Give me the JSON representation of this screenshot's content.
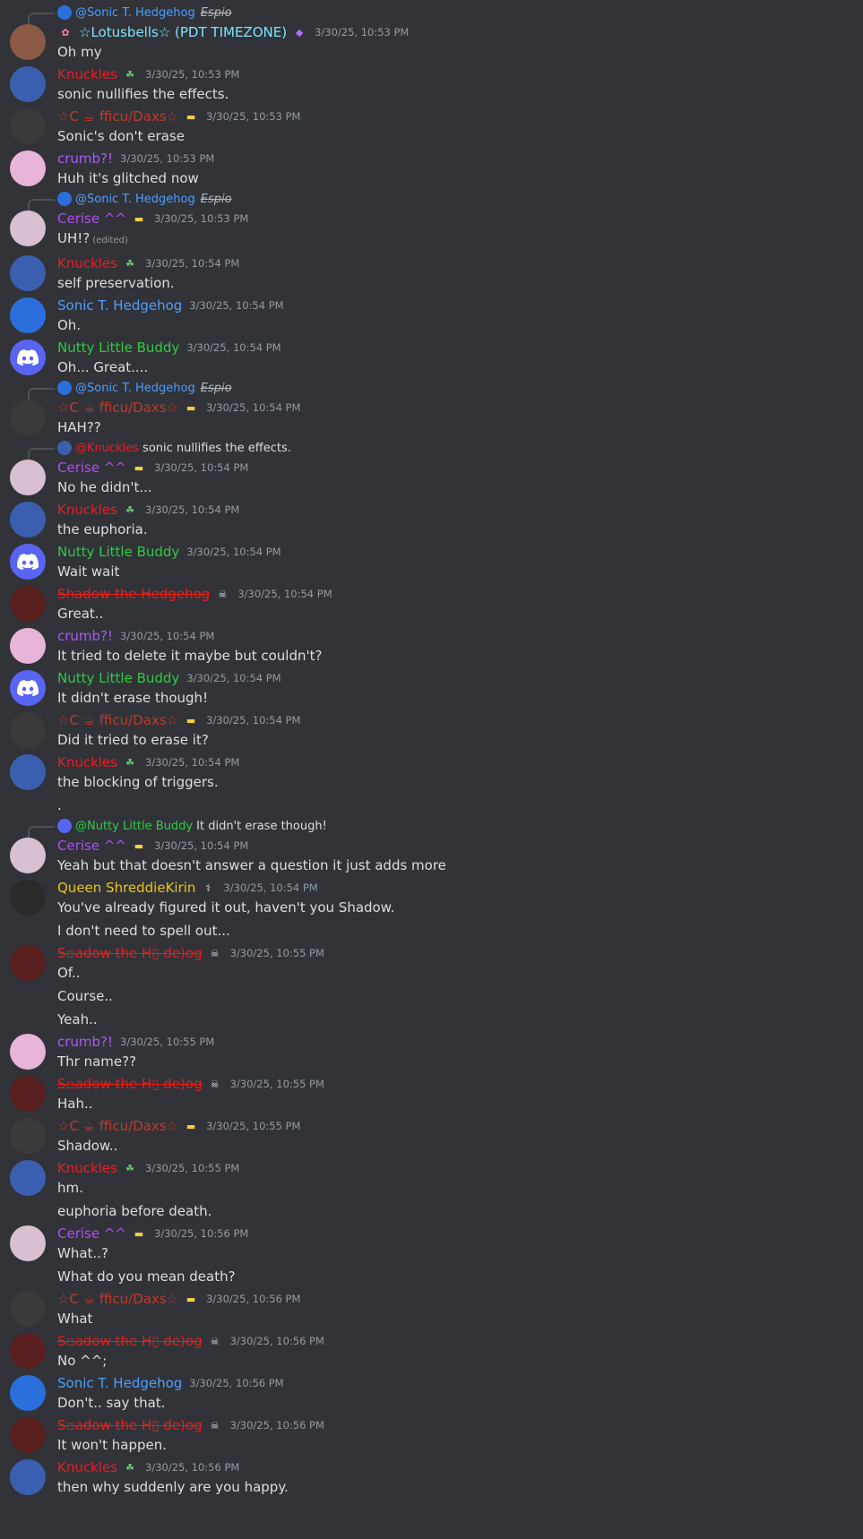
{
  "colors": {
    "background": "#313338",
    "knuckles": "#ed1c24",
    "daxs": "#c0392b",
    "crumb": "#a95cf5",
    "cerise": "#b04ef0",
    "sonic": "#4e9eff",
    "nutty": "#2ecc40",
    "shadow": "#e0211d",
    "queen": "#f1c40f",
    "lotus": "#7ee3ff"
  },
  "messages": [
    {
      "reply": {
        "mention": "@Sonic T. Hedgehog",
        "text": "",
        "tag": "Espio"
      },
      "author": "☆Lotusbells☆ (PDT TIMEZONE)",
      "time": "3/30/25, 10:53 PM",
      "lines": [
        "Oh my"
      ]
    },
    {
      "author": "Knuckles",
      "time": "3/30/25, 10:53 PM",
      "lines": [
        "sonic nullifies the effects."
      ]
    },
    {
      "author": "☆C ☕ fficu/Daxs☆",
      "time": "3/30/25, 10:53 PM",
      "lines": [
        "Sonic's don't erase"
      ]
    },
    {
      "author": "crumb?!",
      "time": "3/30/25, 10:53 PM",
      "lines": [
        "Huh it's glitched now"
      ]
    },
    {
      "reply": {
        "mention": "@Sonic T. Hedgehog",
        "text": "",
        "tag": "Espio"
      },
      "author": "Cerise ^^",
      "time": "3/30/25, 10:53 PM",
      "lines": [
        "UH!?"
      ],
      "edited": "(edited)"
    },
    {
      "author": "Knuckles",
      "time": "3/30/25, 10:54 PM",
      "lines": [
        "self preservation."
      ]
    },
    {
      "author": "Sonic T. Hedgehog",
      "time": "3/30/25, 10:54 PM",
      "lines": [
        "Oh."
      ]
    },
    {
      "author": "Nutty Little Buddy",
      "time": "3/30/25, 10:54 PM",
      "lines": [
        "Oh... Great...."
      ]
    },
    {
      "reply": {
        "mention": "@Sonic T. Hedgehog",
        "text": "",
        "tag": "Espio"
      },
      "author": "☆C ☕ fficu/Daxs☆",
      "time": "3/30/25, 10:54 PM",
      "lines": [
        "HAH??"
      ]
    },
    {
      "reply": {
        "mention": "@Knuckles",
        "text": "sonic nullifies the effects.",
        "tag": ""
      },
      "author": "Cerise ^^",
      "time": "3/30/25, 10:54 PM",
      "lines": [
        "No he didn't..."
      ]
    },
    {
      "author": "Knuckles",
      "time": "3/30/25, 10:54 PM",
      "lines": [
        "the euphoria."
      ]
    },
    {
      "author": "Nutty Little Buddy",
      "time": "3/30/25, 10:54 PM",
      "lines": [
        "Wait wait"
      ]
    },
    {
      "author": "Shadow the Hedgehog",
      "time": "3/30/25, 10:54 PM",
      "lines": [
        "Great.."
      ]
    },
    {
      "author": "crumb?!",
      "time": "3/30/25, 10:54 PM",
      "lines": [
        "It tried to delete it maybe but couldn't?"
      ]
    },
    {
      "author": "Nutty Little Buddy",
      "time": "3/30/25, 10:54 PM",
      "lines": [
        "It didn't erase though!"
      ]
    },
    {
      "author": "☆C ☕ fficu/Daxs☆",
      "time": "3/30/25, 10:54 PM",
      "lines": [
        "Did it tried to erase it?"
      ]
    },
    {
      "author": "Knuckles",
      "time": "3/30/25, 10:54 PM",
      "lines": [
        "the blocking of triggers.",
        "."
      ]
    },
    {
      "reply": {
        "mention": "@Nutty Little Buddy",
        "text": "It didn't erase though!",
        "tag": ""
      },
      "author": "Cerise ^^",
      "time": "3/30/25, 10:54 PM",
      "lines": [
        "Yeah but that doesn't answer a question it just adds more"
      ]
    },
    {
      "author": "Queen ShreddieKirin",
      "time": "3/30/25, 10:54 PM",
      "lines": [
        "You've already figured it out, haven't you Shadow.",
        "I don't need to spell out..."
      ]
    },
    {
      "author": "S▫adow the H▯ de)og",
      "time": "3/30/25, 10:55 PM",
      "lines": [
        "Of..",
        "Course..",
        "Yeah.."
      ]
    },
    {
      "author": "crumb?!",
      "time": "3/30/25, 10:55 PM",
      "lines": [
        "Thr name??"
      ]
    },
    {
      "author": "S▫adow the H▯ de)og",
      "time": "3/30/25, 10:55 PM",
      "lines": [
        "Hah.."
      ]
    },
    {
      "author": "☆C ☕ fficu/Daxs☆",
      "time": "3/30/25, 10:55 PM",
      "lines": [
        "Shadow.."
      ]
    },
    {
      "author": "Knuckles",
      "time": "3/30/25, 10:55 PM",
      "lines": [
        "hm.",
        "euphoria before death."
      ]
    },
    {
      "author": "Cerise ^^",
      "time": "3/30/25, 10:56 PM",
      "lines": [
        "What..?",
        "What do you mean death?"
      ]
    },
    {
      "author": "☆C ☕ fficu/Daxs☆",
      "time": "3/30/25, 10:56 PM",
      "lines": [
        "What"
      ]
    },
    {
      "author": "S▫adow the H▯ de)og",
      "time": "3/30/25, 10:56 PM",
      "lines": [
        "No ^^;"
      ]
    },
    {
      "author": "Sonic T. Hedgehog",
      "time": "3/30/25, 10:56 PM",
      "lines": [
        "Don't.. say that."
      ]
    },
    {
      "author": "S▫adow the H▯ de)og",
      "time": "3/30/25, 10:56 PM",
      "lines": [
        "It won't happen."
      ]
    },
    {
      "author": "Knuckles",
      "time": "3/30/25, 10:56 PM",
      "lines": [
        "then why suddenly are you happy."
      ]
    }
  ],
  "authors": {
    "☆Lotusbells☆ (PDT TIMEZONE)": {
      "color": "#7ee3ff",
      "avatar": "lotus-avatar",
      "bg": "#8a5a44",
      "badge": "gem-icon",
      "prefix": "flower-icon"
    },
    "Knuckles": {
      "color": "#ed1c24",
      "avatar": "knuckles-avatar",
      "bg": "#3b5fb0",
      "badge": "clover-icon"
    },
    "☆C ☕ fficu/Daxs☆": {
      "color": "#c0392b",
      "avatar": "daxs-avatar",
      "bg": "#3a3a3a",
      "badge": "flag-icon"
    },
    "crumb?!": {
      "color": "#a95cf5",
      "avatar": "crumb-avatar",
      "bg": "#e8b4d8"
    },
    "Cerise ^^": {
      "color": "#b04ef0",
      "avatar": "cerise-avatar",
      "bg": "#d8c0d0",
      "badge": "flag-icon"
    },
    "Sonic T. Hedgehog": {
      "color": "#4e9eff",
      "avatar": "sonic-avatar",
      "bg": "#2a6fdb"
    },
    "Nutty Little Buddy": {
      "color": "#2ecc40",
      "avatar": "discord-avatar",
      "bg": "#5865f2"
    },
    "Shadow the Hedgehog": {
      "color": "#e0211d",
      "avatar": "shadow-avatar",
      "bg": "#5a2020",
      "badge": "skull-icon",
      "strike": true
    },
    "S▫adow the H▯ de)og": {
      "color": "#e0211d",
      "avatar": "shadow-avatar",
      "bg": "#5a2020",
      "badge": "skull-icon",
      "strike": true
    },
    "Queen ShreddieKirin": {
      "color": "#f1c40f",
      "avatar": "queen-avatar",
      "bg": "#2a2a2a",
      "badge": "syringe-icon"
    }
  }
}
